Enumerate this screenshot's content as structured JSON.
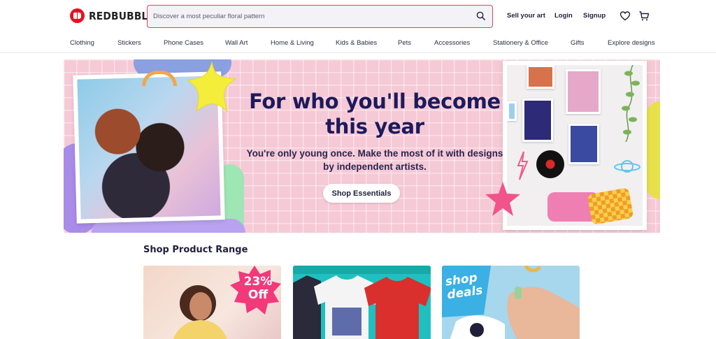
{
  "brand": {
    "logo_text": "REDBUBBLE",
    "accent": "#e41321"
  },
  "search": {
    "placeholder": "Discover a most peculiar floral pattern",
    "border_color": "#e0415a"
  },
  "header_links": {
    "sell": "Sell your art",
    "login": "Login",
    "signup": "Signup"
  },
  "header_icons": [
    "heart-icon",
    "cart-icon",
    "search-icon"
  ],
  "nav": {
    "items": [
      {
        "label": "Clothing"
      },
      {
        "label": "Stickers"
      },
      {
        "label": "Phone Cases"
      },
      {
        "label": "Wall Art"
      },
      {
        "label": "Home & Living"
      },
      {
        "label": "Kids & Babies"
      },
      {
        "label": "Pets"
      },
      {
        "label": "Accessories"
      },
      {
        "label": "Stationery & Office"
      },
      {
        "label": "Gifts"
      },
      {
        "label": "Explore designs"
      }
    ]
  },
  "hero": {
    "title": "For who you'll become this year",
    "subtitle": "You're only young once. Make the most of it with designs by independent artists.",
    "button": "Shop Essentials",
    "bg_color": "#f6c9d6",
    "title_color": "#1d1a5c"
  },
  "product_range": {
    "title": "Shop Product Range",
    "cards": [
      {
        "badge": "23% Off"
      },
      {
        "badge": ""
      },
      {
        "badge": "shop deals"
      }
    ]
  }
}
